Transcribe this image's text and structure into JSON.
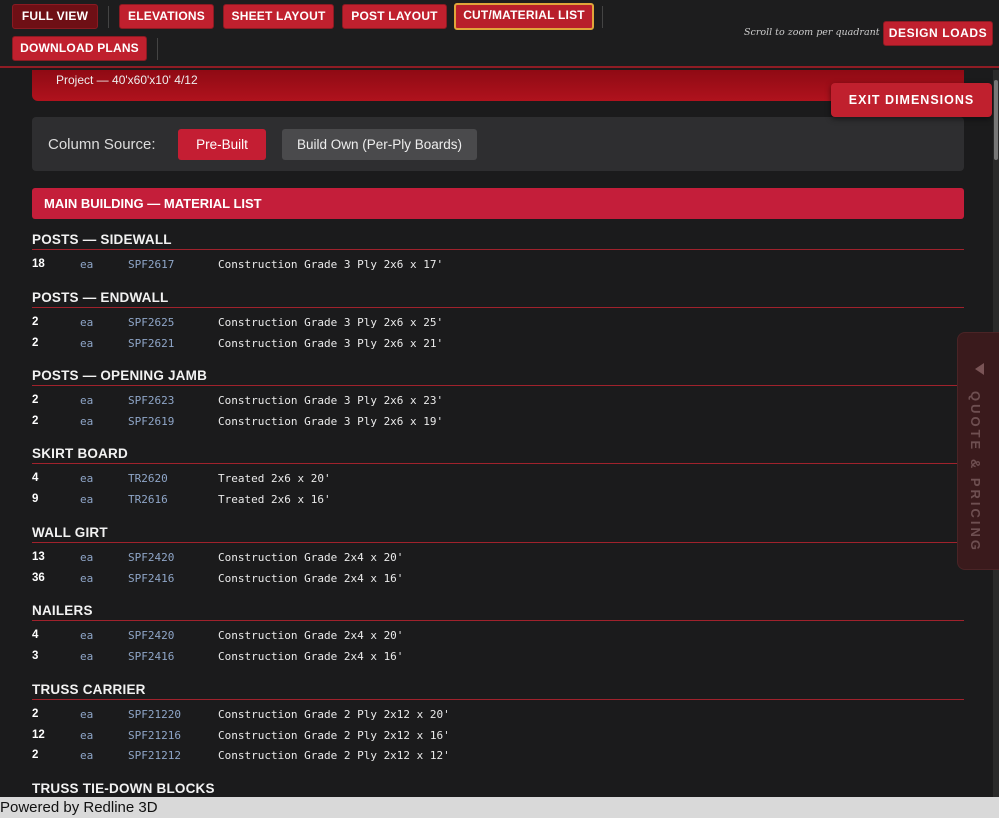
{
  "toolbar": {
    "full_view": "FULL VIEW",
    "elevations": "ELEVATIONS",
    "sheet_layout": "SHEET LAYOUT",
    "post_layout": "POST LAYOUT",
    "cut_material_list": "CUT/MATERIAL LIST",
    "download_plans": "DOWNLOAD PLANS",
    "zoom_hint": "Scroll to zoom per quadrant",
    "design_loads": "DESIGN LOADS"
  },
  "project_label": "Project — 40'x60'x10' 4/12",
  "exit_dimensions": "EXIT DIMENSIONS",
  "column_source": {
    "label": "Column Source:",
    "options": [
      "Pre-Built",
      "Build Own (Per-Ply Boards)"
    ],
    "selected": "Pre-Built"
  },
  "main_header": "MAIN BUILDING — MATERIAL LIST",
  "sections": [
    {
      "title": "POSTS — SIDEWALL",
      "rows": [
        {
          "qty": "18",
          "unit": "ea",
          "code": "SPF2617",
          "desc": "Construction Grade 3 Ply 2x6 x 17'"
        }
      ]
    },
    {
      "title": "POSTS — ENDWALL",
      "rows": [
        {
          "qty": "2",
          "unit": "ea",
          "code": "SPF2625",
          "desc": "Construction Grade 3 Ply 2x6 x 25'"
        },
        {
          "qty": "2",
          "unit": "ea",
          "code": "SPF2621",
          "desc": "Construction Grade 3 Ply 2x6 x 21'"
        }
      ]
    },
    {
      "title": "POSTS — OPENING JAMB",
      "rows": [
        {
          "qty": "2",
          "unit": "ea",
          "code": "SPF2623",
          "desc": "Construction Grade 3 Ply 2x6 x 23'"
        },
        {
          "qty": "2",
          "unit": "ea",
          "code": "SPF2619",
          "desc": "Construction Grade 3 Ply 2x6 x 19'"
        }
      ]
    },
    {
      "title": "SKIRT BOARD",
      "rows": [
        {
          "qty": "4",
          "unit": "ea",
          "code": "TR2620",
          "desc": "Treated 2x6 x 20'"
        },
        {
          "qty": "9",
          "unit": "ea",
          "code": "TR2616",
          "desc": "Treated 2x6 x 16'"
        }
      ]
    },
    {
      "title": "WALL GIRT",
      "rows": [
        {
          "qty": "13",
          "unit": "ea",
          "code": "SPF2420",
          "desc": "Construction Grade 2x4 x 20'"
        },
        {
          "qty": "36",
          "unit": "ea",
          "code": "SPF2416",
          "desc": "Construction Grade 2x4 x 16'"
        }
      ]
    },
    {
      "title": "NAILERS",
      "rows": [
        {
          "qty": "4",
          "unit": "ea",
          "code": "SPF2420",
          "desc": "Construction Grade 2x4 x 20'"
        },
        {
          "qty": "3",
          "unit": "ea",
          "code": "SPF2416",
          "desc": "Construction Grade 2x4 x 16'"
        }
      ]
    },
    {
      "title": "TRUSS CARRIER",
      "rows": [
        {
          "qty": "2",
          "unit": "ea",
          "code": "SPF21220",
          "desc": "Construction Grade 2 Ply 2x12 x 20'"
        },
        {
          "qty": "12",
          "unit": "ea",
          "code": "SPF21216",
          "desc": "Construction Grade 2 Ply 2x12 x 16'"
        },
        {
          "qty": "2",
          "unit": "ea",
          "code": "SPF21212",
          "desc": "Construction Grade 2 Ply 2x12 x 12'"
        }
      ]
    },
    {
      "title": "TRUSS TIE-DOWN BLOCKS",
      "rows": []
    }
  ],
  "quote_tab": "QUOTE & PRICING",
  "footer": "Powered by Redline 3D",
  "colors": {
    "accent": "#c41e3a",
    "background": "#1b1b1c",
    "code_text": "#8fa6c8"
  }
}
